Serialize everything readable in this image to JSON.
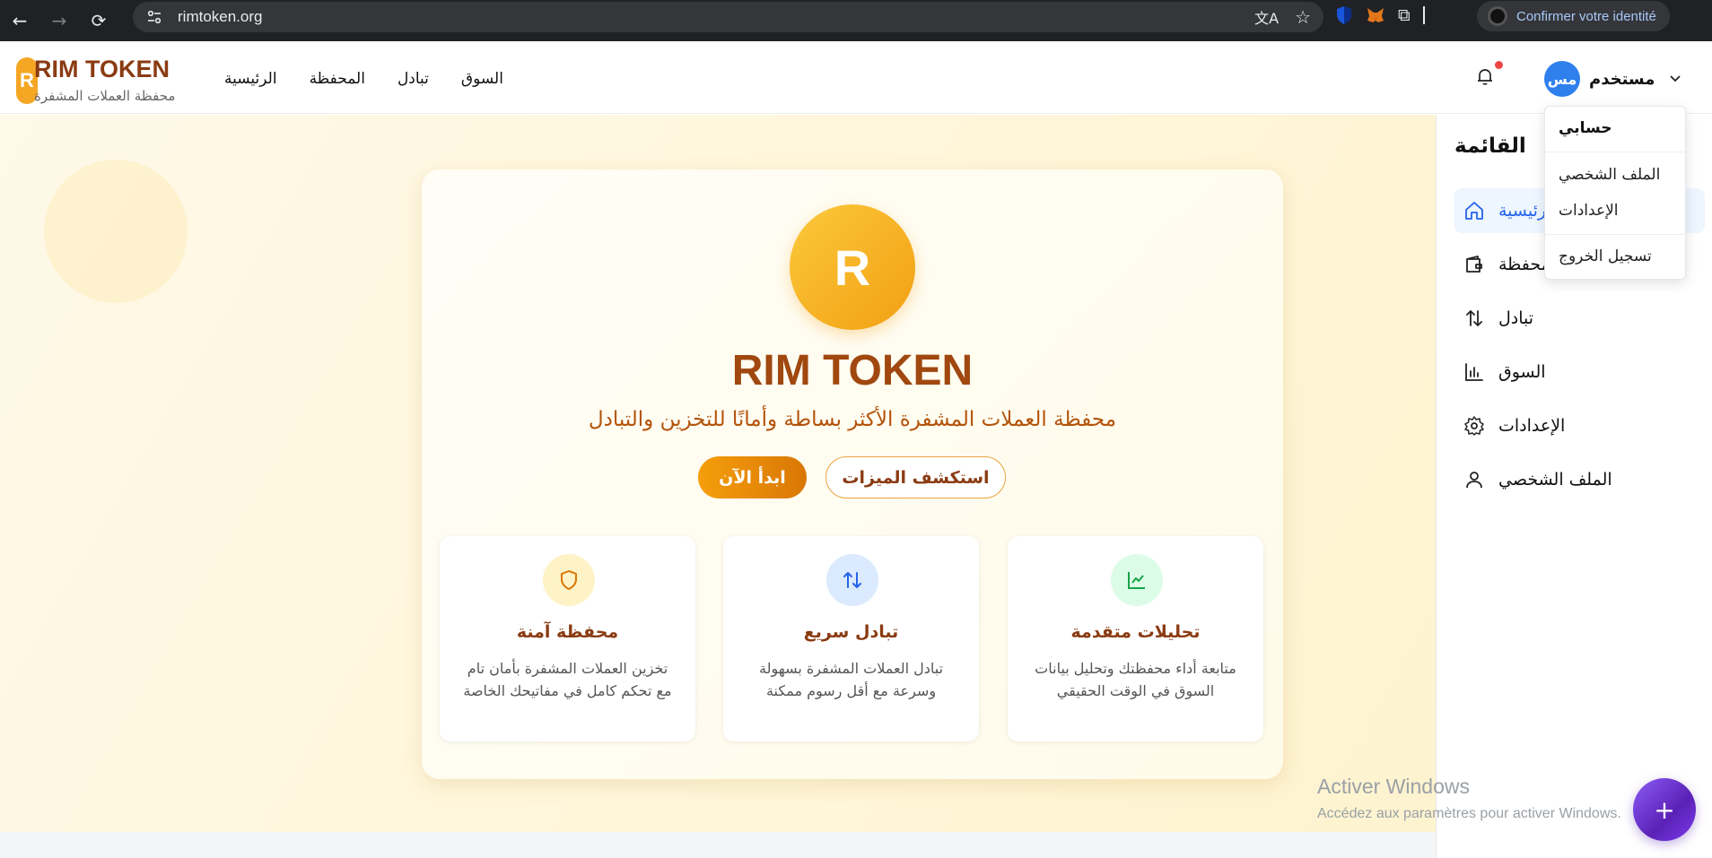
{
  "browser": {
    "url": "rimtoken.org",
    "identity_button": "Confirmer votre identité"
  },
  "header": {
    "logo_letter": "R",
    "brand": "RIM TOKEN",
    "brand_subtitle": "محفظة العملات المشفرة",
    "nav": [
      "الرئيسية",
      "المحفظة",
      "تبادل",
      "السوق"
    ],
    "user_initials": "مس",
    "user_name": "مستخدم"
  },
  "user_menu": {
    "heading": "حسابي",
    "items": [
      "الملف الشخصي",
      "الإعدادات",
      "تسجيل الخروج"
    ]
  },
  "hero": {
    "logo_letter": "R",
    "title": "RIM TOKEN",
    "subtitle": "محفظة العملات المشفرة الأكثر بساطة وأمانًا للتخزين والتبادل",
    "primary_button": "ابدأ الآن",
    "secondary_button": "استكشف الميزات",
    "features": [
      {
        "icon": "shield-icon",
        "title": "محفظة آمنة",
        "desc": "تخزين العملات المشفرة بأمان تام مع تحكم كامل في مفاتيحك الخاصة",
        "color": "#d97706",
        "bg": "#fef3c7"
      },
      {
        "icon": "arrows-up-down-icon",
        "title": "تبادل سريع",
        "desc": "تبادل العملات المشفرة بسهولة وسرعة مع أقل رسوم ممكنة",
        "color": "#2563eb",
        "bg": "#dbeafe"
      },
      {
        "icon": "chart-line-icon",
        "title": "تحليلات متقدمة",
        "desc": "متابعة أداء محفظتك وتحليل بيانات السوق في الوقت الحقيقي",
        "color": "#16a34a",
        "bg": "#dcfce7"
      }
    ]
  },
  "sidebar": {
    "title": "القائمة",
    "items": [
      {
        "label": "الرئيسية",
        "icon": "home-icon",
        "active": true
      },
      {
        "label": "المحفظة",
        "icon": "wallet-icon"
      },
      {
        "label": "تبادل",
        "icon": "arrows-up-down-icon"
      },
      {
        "label": "السوق",
        "icon": "bar-chart-icon"
      },
      {
        "label": "الإعدادات",
        "icon": "gear-icon"
      },
      {
        "label": "الملف الشخصي",
        "icon": "user-icon"
      }
    ]
  },
  "watermark": {
    "line1": "Activer Windows",
    "line2": "Accédez aux paramètres pour activer Windows."
  },
  "fab_label": "+"
}
